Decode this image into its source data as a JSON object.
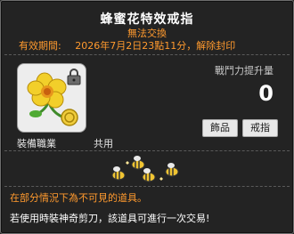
{
  "item": {
    "name": "蜂蜜花特效戒指",
    "trade_status": "無法交換",
    "expiry_label": "有效期間:",
    "expiry_value": "2026年7月2日23點11分，解除封印",
    "stat_label": "戰鬥力提升量",
    "stat_value": "0",
    "categories": [
      "飾品",
      "戒指"
    ],
    "job_label": "裝備職業",
    "job_value": "共用",
    "description_warning": "在部分情況下為不可見的道具。",
    "description_note": "若使用時裝神奇剪刀，該道具可進行一次交易!",
    "icon": "yellow-flower-with-lock-icon"
  },
  "colors": {
    "background": "#232323",
    "accent_orange": "#ff9a2e",
    "text_white": "#ffffff"
  }
}
